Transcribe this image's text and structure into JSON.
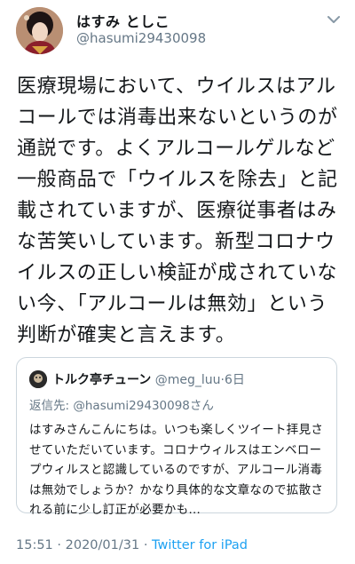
{
  "header": {
    "display_name": "はすみ としこ",
    "handle": "@hasumi29430098",
    "menu_icon": "chevron-down-icon"
  },
  "tweet": {
    "text": "医療現場において、ウイルスはアルコールでは消毒出来ないというのが通説です。よくアルコールゲルなど一般商品で「ウイルスを除去」と記載されていますが、医療従事者はみな苦笑いしています。新型コロナウイルスの正しい検証が成されていない今、「アルコールは無効」という判断が確実と言えます。"
  },
  "quoted_tweet": {
    "display_name": "トルク亭チューン",
    "handle": "@meg_luu",
    "separator": "·",
    "age": "6日",
    "reply_prefix": "返信先:",
    "reply_handle": "@hasumi29430098",
    "reply_suffix": "さん",
    "text": "はすみさんこんにちは。いつも楽しくツイート拝見させていただいています。コロナウィルスはエンベロープウィルスと認識しているのですが、アルコール消毒は無効でしょうか？かなり具体的な文章なので拡散される前に少し訂正が必要かも…"
  },
  "footer": {
    "time": "15:51",
    "separator": "·",
    "date": "2020/01/31",
    "source": "Twitter for iPad"
  },
  "colors": {
    "link": "#1da1f2",
    "secondary_text": "#657786",
    "border": "#ccd6dd"
  }
}
